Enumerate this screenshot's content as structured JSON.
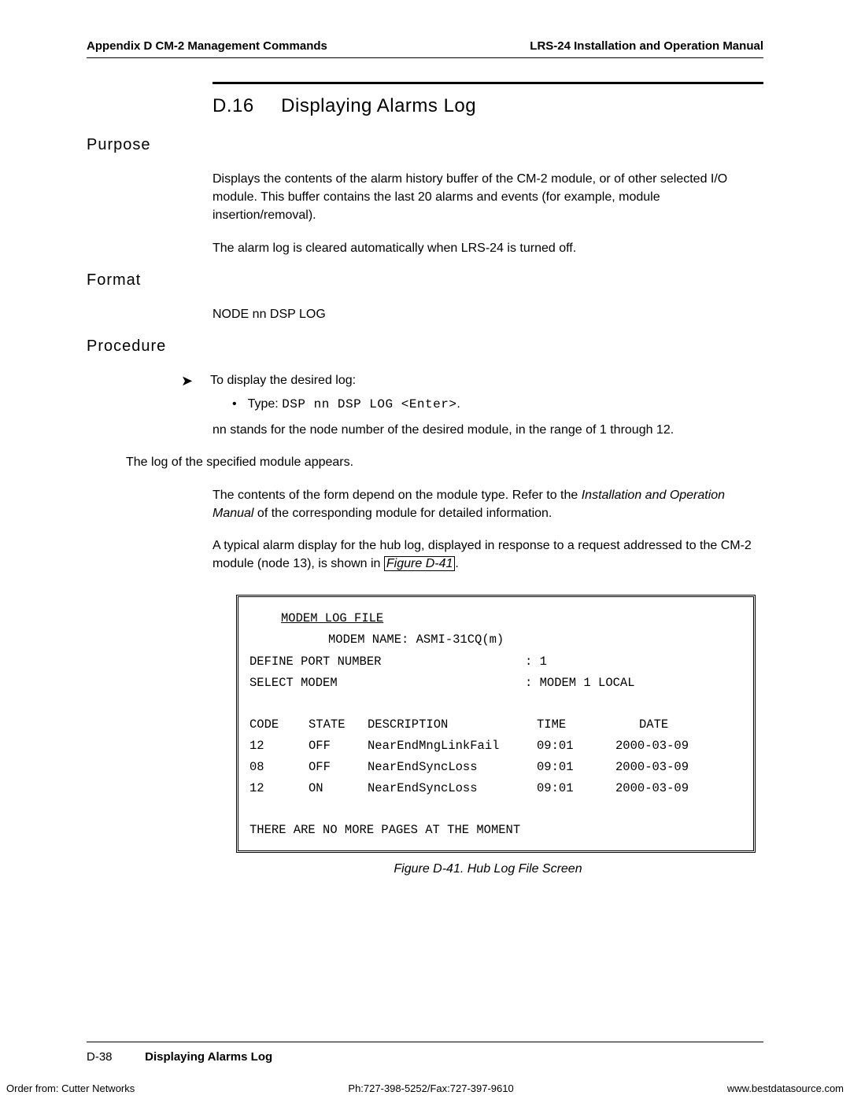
{
  "header": {
    "left": "Appendix D  CM-2 Management Commands",
    "right": "LRS-24 Installation and Operation Manual"
  },
  "section": {
    "number": "D.16",
    "title": "Displaying Alarms Log"
  },
  "purpose": {
    "heading": "Purpose",
    "para1": "Displays the contents of the alarm history buffer of the CM-2 module, or of other selected I/O module. This buffer contains the last 20 alarms and events (for example, module insertion/removal).",
    "para2": "The alarm log is cleared automatically when LRS-24 is turned off."
  },
  "format": {
    "heading": "Format",
    "value": "NODE nn DSP LOG"
  },
  "procedure": {
    "heading": "Procedure",
    "step1": "To display the desired log:",
    "bullet_prefix": "Type: ",
    "bullet_cmd": "DSP nn DSP LOG <Enter>",
    "bullet_suffix": ".",
    "nn_para": "nn stands for the node number of the desired module, in the range of 1 through 12.",
    "log_appears": "The log of the specified module appears.",
    "contents_prefix": "The contents of the form depend on the module type. Refer to the ",
    "contents_italic1": "Installation and Operation Manual",
    "contents_suffix": " of the corresponding module for detailed information.",
    "typical_prefix": "A typical alarm display for the hub log, displayed in response to a request addressed to the CM-2 module (node 13), is shown in ",
    "figref": "Figure D-41",
    "typical_suffix": "."
  },
  "terminal": {
    "title": "MODEM LOG FILE",
    "modem_name": "MODEM NAME: ASMI-31CQ(m)",
    "define_label": "DEFINE PORT NUMBER",
    "define_val": ": 1",
    "select_label": "SELECT MODEM",
    "select_val": ": MODEM 1 LOCAL",
    "headers": {
      "code": "CODE",
      "state": "STATE",
      "desc": "DESCRIPTION",
      "time": "TIME",
      "date": "DATE"
    },
    "rows": [
      {
        "code": "12",
        "state": "OFF",
        "desc": "NearEndMngLinkFail",
        "time": "09:01",
        "date": "2000-03-09"
      },
      {
        "code": "08",
        "state": "OFF",
        "desc": "NearEndSyncLoss",
        "time": "09:01",
        "date": "2000-03-09"
      },
      {
        "code": "12",
        "state": "ON",
        "desc": "NearEndSyncLoss",
        "time": "09:01",
        "date": "2000-03-09"
      }
    ],
    "footer": "THERE ARE NO MORE PAGES AT THE MOMENT"
  },
  "fig_caption": "Figure D-41.  Hub Log File Screen",
  "footer": {
    "pagenum": "D-38",
    "section": "Displaying Alarms Log"
  },
  "bottom": {
    "left": "Order from: Cutter Networks",
    "center": "Ph:727-398-5252/Fax:727-397-9610",
    "right": "www.bestdatasource.com"
  }
}
